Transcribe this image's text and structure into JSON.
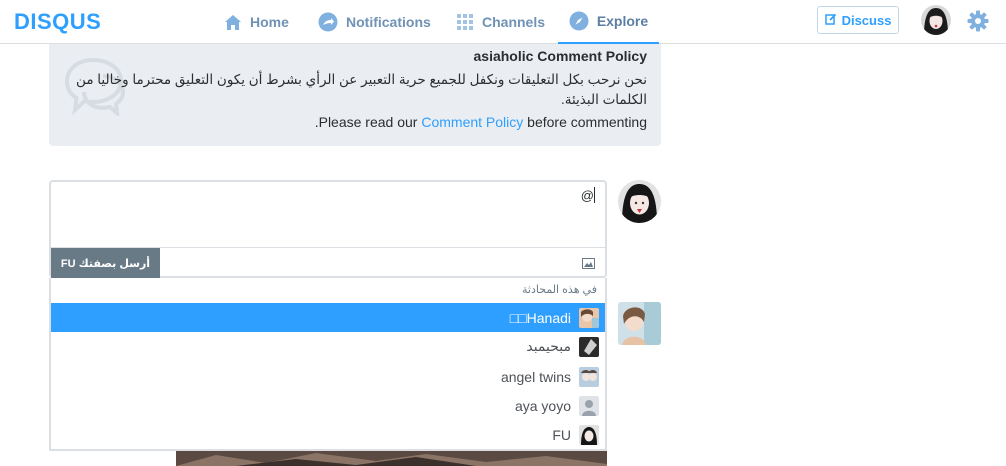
{
  "brand": {
    "logo": "DISQUS"
  },
  "nav": {
    "home": "Home",
    "notifications": "Notifications",
    "channels": "Channels",
    "explore": "Explore",
    "discuss": "Discuss"
  },
  "policy": {
    "title": "asiaholic Comment Policy",
    "text": "نحن نرحب بكل التعليقات ونكفل للجميع حرية التعبير عن الرأي بشرط أن يكون التعليق محترما وخاليا من الكلمات البذيئة.",
    "read_before": "Please read our ",
    "link": "Comment Policy",
    "read_after": " before commenting",
    "read_end": "."
  },
  "composer": {
    "text": "@",
    "send_label": "أرسل بصفتك FU"
  },
  "mention": {
    "header": "في هذه المحادثة",
    "items": [
      {
        "name": "□□Hanadi",
        "selected": true
      },
      {
        "name": "مبحيمبد",
        "selected": false
      },
      {
        "name": "angel twins",
        "selected": false
      },
      {
        "name": "aya yoyo",
        "selected": false
      },
      {
        "name": "FU",
        "selected": false
      }
    ]
  },
  "colors": {
    "accent": "#2e9fff",
    "nav": "#7092b5",
    "policy_bg": "#eaedf2",
    "send_bg": "#687a86"
  },
  "icons": [
    "home-icon",
    "notifications-icon",
    "channels-icon",
    "explore-icon",
    "edit-icon",
    "gear-icon",
    "comment-bubble-icon",
    "image-icon"
  ]
}
